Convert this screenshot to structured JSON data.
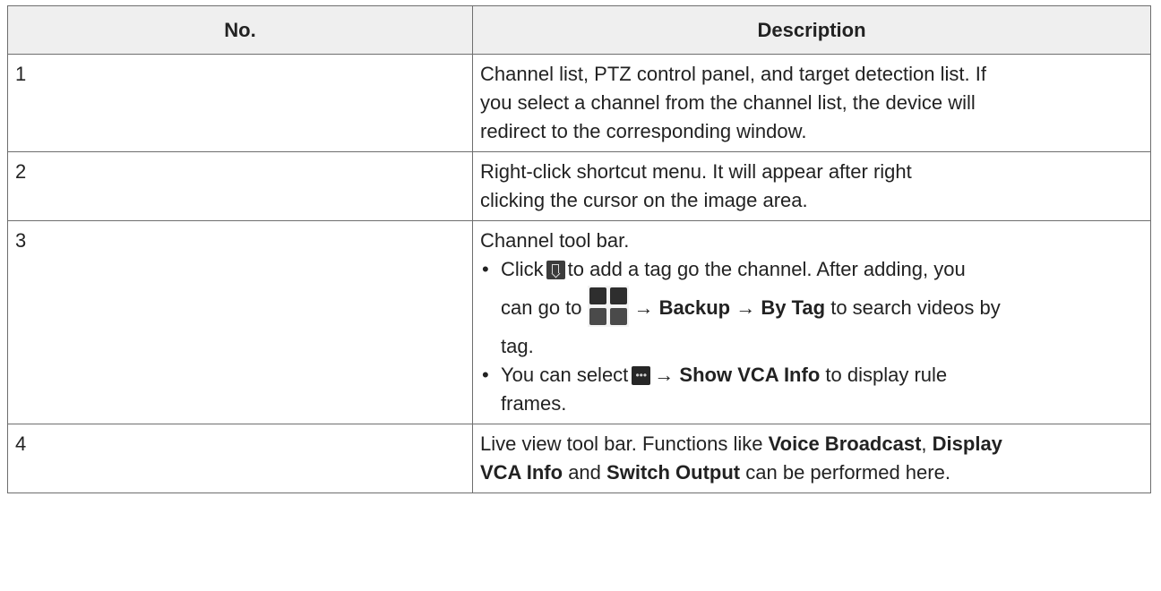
{
  "table": {
    "headers": {
      "no": "No.",
      "description": "Description"
    },
    "rows": [
      {
        "no": "1",
        "lines": [
          "Channel list, PTZ control panel, and target detection list. If",
          "you select a channel from the channel list, the device will",
          "redirect to the corresponding window."
        ]
      },
      {
        "no": "2",
        "lines": [
          "Right-click shortcut menu. It will appear after right",
          "clicking the cursor on the image area."
        ]
      },
      {
        "no": "3",
        "intro": "Channel tool bar.",
        "bullet1": {
          "click": "Click",
          "after_icon": "to add a tag go the channel. After adding, you",
          "can_go_to": "can go to",
          "arrow": "→",
          "backup": "Backup",
          "by_tag": "By Tag",
          "rest": "to search videos by",
          "tail": "tag."
        },
        "bullet2": {
          "lead": "You can select",
          "arrow": "→",
          "show_vca": "Show VCA Info",
          "rest": "to display rule",
          "tail": "frames."
        }
      },
      {
        "no": "4",
        "lead": "Live view tool bar. Functions like",
        "voice": "Voice Broadcast",
        "comma": ",",
        "display": "Display",
        "vca_info": "VCA Info",
        "and": "and",
        "switch_output": "Switch Output",
        "rest": "can be performed here."
      }
    ]
  },
  "icons": {
    "tag": "bookmark-tag-icon",
    "menu": "main-menu-grid-icon",
    "more": "more-options-icon"
  }
}
